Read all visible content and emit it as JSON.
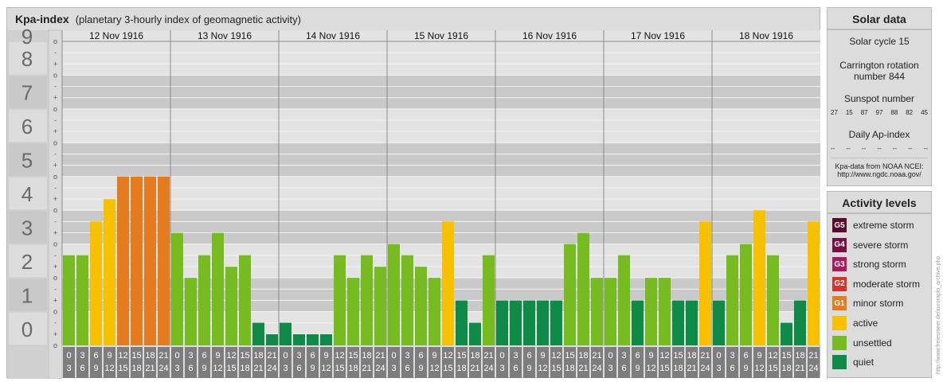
{
  "header": {
    "title": "Kpa-index",
    "subtitle": "(planetary 3-hourly index of geomagnetic activity)"
  },
  "chart_data": {
    "type": "bar",
    "title": "Kpa-index",
    "subtitle": "(planetary 3-hourly index of geomagnetic activity)",
    "ylim": [
      0,
      9
    ],
    "y_ticks": [
      "0",
      "1",
      "2",
      "3",
      "4",
      "5",
      "6",
      "7",
      "8",
      "9"
    ],
    "minor_tick_marks": [
      "o",
      "+",
      "-"
    ],
    "days": [
      "12 Nov 1916",
      "13 Nov 1916",
      "14 Nov 1916",
      "15 Nov 1916",
      "16 Nov 1916",
      "17 Nov 1916",
      "18 Nov 1916"
    ],
    "interval_starts": [
      "0",
      "3",
      "6",
      "9",
      "12",
      "15",
      "18",
      "21"
    ],
    "interval_ends": [
      "3",
      "6",
      "9",
      "12",
      "15",
      "18",
      "21",
      "24"
    ],
    "values": [
      [
        2.67,
        2.67,
        3.67,
        4.33,
        5.0,
        5.0,
        5.0,
        5.0
      ],
      [
        3.33,
        2.0,
        2.67,
        3.33,
        2.33,
        2.67,
        0.67,
        0.33
      ],
      [
        0.67,
        0.33,
        0.33,
        0.33,
        2.67,
        2.0,
        2.67,
        2.33
      ],
      [
        3.0,
        2.67,
        2.33,
        2.0,
        3.67,
        1.33,
        0.67,
        2.67
      ],
      [
        1.33,
        1.33,
        1.33,
        1.33,
        1.33,
        3.0,
        3.33,
        2.0
      ],
      [
        2.0,
        2.67,
        1.33,
        2.0,
        2.0,
        1.33,
        1.33,
        3.67
      ],
      [
        1.33,
        2.67,
        3.0,
        4.0,
        2.67,
        0.67,
        1.33,
        3.67
      ]
    ],
    "colors": {
      "quiet": "#0f8b47",
      "unsettled": "#76bc20",
      "active": "#f7c100",
      "minor_storm": "#e57b1e"
    },
    "grid": true,
    "legend": "right"
  },
  "solar": {
    "title": "Solar data",
    "cycle": "Solar cycle 15",
    "carrington_1": "Carrington rotation",
    "carrington_2": "number 844",
    "sunspot_label": "Sunspot number",
    "sunspots": [
      "27",
      "15",
      "87",
      "97",
      "88",
      "82",
      "45"
    ],
    "ap_label": "Daily Ap-index",
    "ap_values": [
      "--",
      "--",
      "--",
      "--",
      "--",
      "--",
      "--"
    ],
    "source_1": "Kpa-data from NOAA NCEI:",
    "source_2": "http://www.ngdc.noaa.gov/"
  },
  "levels": {
    "title": "Activity levels",
    "items": [
      {
        "code": "G5",
        "label": "extreme storm",
        "color": "#5a0a2a"
      },
      {
        "code": "G4",
        "label": "severe storm",
        "color": "#7a1042"
      },
      {
        "code": "G3",
        "label": "strong storm",
        "color": "#b3165a"
      },
      {
        "code": "G2",
        "label": "moderate storm",
        "color": "#d6322a"
      },
      {
        "code": "G1",
        "label": "minor storm",
        "color": "#e57b1e"
      },
      {
        "code": "",
        "label": "active",
        "color": "#f7c100"
      },
      {
        "code": "",
        "label": "unsettled",
        "color": "#76bc20"
      },
      {
        "code": "",
        "label": "quiet",
        "color": "#0f8b47"
      }
    ]
  },
  "credit": "http://www.freiesmeer.de/auroraplo_archive.php"
}
